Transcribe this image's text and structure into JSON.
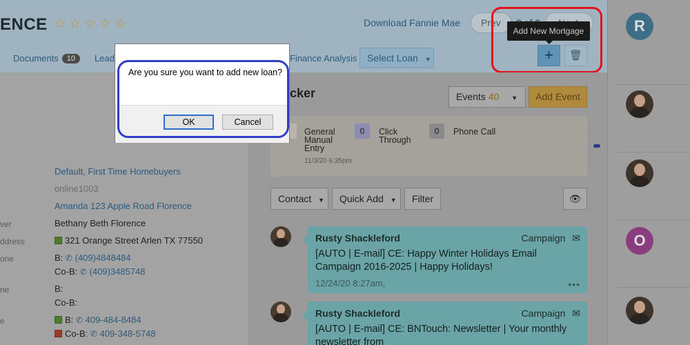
{
  "header": {
    "contact_name": "ENCE",
    "stars": [
      "☆",
      "☆",
      "☆",
      "☆",
      "☆"
    ],
    "download_link": "Download Fannie Mae",
    "prev_label": "Prev",
    "page_counter": "2 of 2",
    "next_label": "Next"
  },
  "tabs": {
    "documents_label": "Documents",
    "documents_count": "10",
    "leads_label": "Lead",
    "finance_label": "Finance Analysis",
    "select_loan_label": "Select Loan"
  },
  "mortgage_actions": {
    "tooltip": "Add New Mortgage",
    "add_glyph": "+",
    "delete_glyph": "🗑"
  },
  "details": {
    "tags": "Default, First Time Homebuyers",
    "source": "online1003",
    "loan_name": "Amanda 123 Apple Road Florence",
    "buyer_label": "ver",
    "buyer_value": "Bethany Beth Florence",
    "address_label": "ddress",
    "address_value": "321 Orange Street Arlen TX 77550",
    "home_phone_label": "one",
    "home_phone_b": "B:",
    "home_phone_b_value": "(409)4848484",
    "home_phone_cob": "Co-B:",
    "home_phone_cob_value": "(409)3485748",
    "work_phone_label": "ne",
    "work_phone_b": "B:",
    "work_phone_cob": "Co-B:",
    "cell_label": "e",
    "cell_b": "B:",
    "cell_b_value": "409-484-8484",
    "cell_cob": "Co-B:",
    "cell_cob_value": "409-348-5748"
  },
  "tracker": {
    "title": "cker",
    "events_label": "Events",
    "events_count": "40",
    "add_event_label": "Add Event",
    "stats": [
      {
        "count": "",
        "label": "General\nManual\nEntry"
      },
      {
        "count": "0",
        "label": "Click\nThrough"
      },
      {
        "count": "0",
        "label": "Phone Call"
      }
    ],
    "stats_date": "11/3/20 6:35pm"
  },
  "feed_toolbar": {
    "contact_label": "Contact",
    "quick_add_label": "Quick Add",
    "filter_label": "Filter",
    "eye_glyph": "👁"
  },
  "feed": [
    {
      "name": "Rusty Shackleford",
      "type": "Campaign",
      "text": "[AUTO | E-mail] CE: Happy Winter Holidays Email Campaign 2016-2025 | Happy Holidays!",
      "date": "12/24/20 8:27am,",
      "more": "•••"
    },
    {
      "name": "Rusty Shackleford",
      "type": "Campaign",
      "text": "[AUTO | E-mail] CE: BNTouch: Newsletter | Your monthly newsletter from",
      "date": "",
      "more": ""
    }
  ],
  "sidebar": {
    "letter_r": "R",
    "letter_o": "O"
  },
  "dialog": {
    "message": "Are you sure you want to add new loan?",
    "ok_label": "OK",
    "cancel_label": "Cancel"
  },
  "colors": {
    "red_annotation": "#e0121b",
    "blue_annotation": "#2f3fc4",
    "ok_focus": "#2f6fc9"
  }
}
